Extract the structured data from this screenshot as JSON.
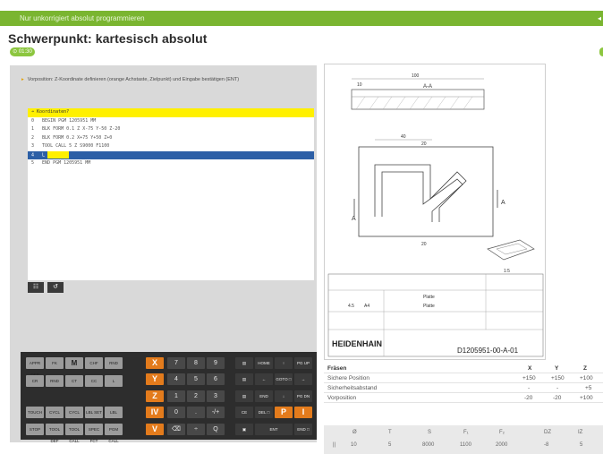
{
  "topbar": {
    "text": "Nur unkorrigiert absolut programmieren",
    "arrow": "◂"
  },
  "title": "Schwerpunkt: kartesisch absolut",
  "timer": "⊙ 01:30",
  "instruction": "Vorposition: Z-Koordinate definieren (orange Achstaste, Zielpunkt) und Eingabe bestätigen (ENT)",
  "nc_program": [
    {
      "text": "➔ Koordinaten?",
      "state": "active"
    },
    {
      "text": "0   BEGIN PGM 1205951 MM",
      "state": "normal"
    },
    {
      "text": "1   BLK FORM 0.1 Z X-75 Y-50 Z-20",
      "state": "normal"
    },
    {
      "text": "2   BLK FORM 0.2 X+75 Y+50 Z+0",
      "state": "normal"
    },
    {
      "text": "3   TOOL CALL 5 Z S9000 F1100",
      "state": "normal"
    },
    {
      "text": "4   L",
      "state": "selected"
    },
    {
      "text": "5   END PGM 1205951 MM",
      "state": "normal"
    }
  ],
  "soft_buttons": [
    "layout-icon",
    "undo-icon"
  ],
  "keyboard": {
    "left_keys": [
      [
        "APPR DEP",
        "FK",
        "M",
        "CHF",
        "RND"
      ],
      [
        "CR",
        "RND",
        "CT",
        "CC",
        "L"
      ],
      [
        "TOUCH PROBE",
        "CYCL DEF",
        "CYCL CALL",
        "LBL SET",
        "LBL CALL"
      ],
      [
        "STOP",
        "TOOL DEF",
        "TOOL CALL",
        "SPEC FCT",
        "PGM CALL"
      ]
    ],
    "axis_keys": [
      "X",
      "Y",
      "Z",
      "IV",
      "V"
    ],
    "num_keys": [
      [
        "7",
        "8",
        "9"
      ],
      [
        "4",
        "5",
        "6"
      ],
      [
        "1",
        "2",
        "3"
      ],
      [
        "0",
        ".",
        "-/+"
      ],
      [
        "⌫",
        "÷",
        "Q"
      ]
    ],
    "right_keys": [
      [
        "▤",
        "HOME",
        "↑",
        "PG UP"
      ],
      [
        "▤",
        "←",
        "GOTO □",
        "→"
      ],
      [
        "▤",
        "END",
        "↓",
        "PG DN"
      ],
      [
        "CE",
        "DEL □",
        "P",
        "I"
      ],
      [
        "▣",
        "ENT",
        "",
        "END □"
      ]
    ],
    "orange_right": [
      "P",
      "I"
    ]
  },
  "drawing": {
    "section_label": "A-A",
    "dims": [
      "100",
      "10",
      "40",
      "20",
      "20",
      "A",
      "A",
      "1:5"
    ],
    "title_block": {
      "part": "Platte",
      "part2": "Platte",
      "brand": "HEIDENHAIN",
      "drawing_no": "D1205951-00-A-01",
      "scale1": "4.5",
      "scale2": "A4"
    }
  },
  "table": {
    "title": "Fräsen",
    "headers": [
      "X",
      "Y",
      "Z"
    ],
    "rows": [
      {
        "label": "Sichere Position",
        "x": "+150",
        "y": "+150",
        "z": "+100"
      },
      {
        "label": "Sicherheitsabstand",
        "x": "-",
        "y": "-",
        "z": "+5"
      },
      {
        "label": "Vorposition",
        "x": "-20",
        "y": "-20",
        "z": "+100"
      }
    ]
  },
  "tool_table": {
    "headers": [
      "Ø",
      "T",
      "S",
      "F₁",
      "F₂",
      "DZ",
      "IZ"
    ],
    "values": [
      "10",
      "5",
      "8000",
      "1100",
      "2000",
      "-8",
      "5"
    ]
  }
}
